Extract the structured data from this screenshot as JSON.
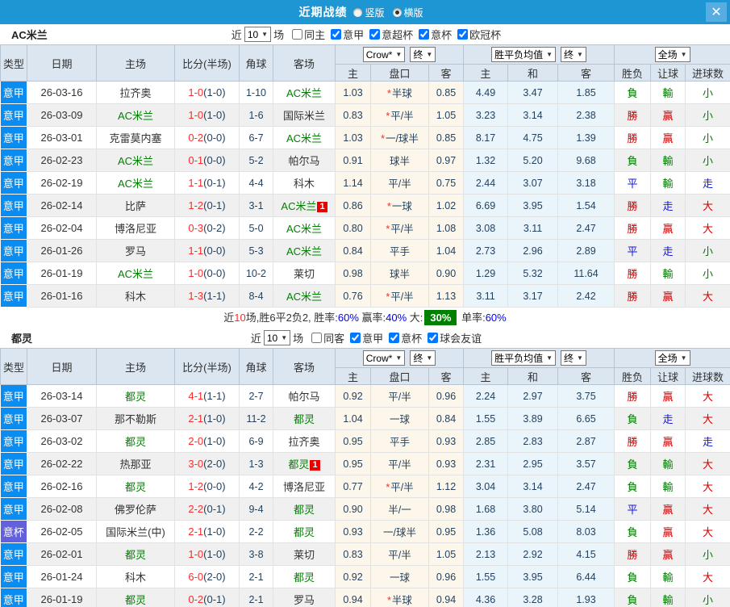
{
  "colors": {
    "bar": "#1e96d4",
    "barBtn": "#57ace1",
    "headerBg": "#dce6f1",
    "headerBorder": "#b7c4d3",
    "cellBorder": "#e2e2e2",
    "altRow": "#f0f0f0",
    "crowBg": "#fdf6ea",
    "avgBg": "#e9f4fb",
    "leagueBlue": "#0b8cf0",
    "cupPurple": "#6360dd",
    "teamGreen": "#008000",
    "scoreRed": "#ff2a2a",
    "numNavy": "#24425f",
    "winRed": "#d20000",
    "loseGreen": "#007800",
    "drawBlue": "#1515dd",
    "pctBlue": "#0000ee",
    "boxGreen": "#008000"
  },
  "header": {
    "title": "近期战绩",
    "close_glyph": "✕",
    "radios": [
      {
        "label": "竖版",
        "selected": false
      },
      {
        "label": "横版",
        "selected": true
      }
    ]
  },
  "columns": {
    "type": "类型",
    "date": "日期",
    "home": "主场",
    "score": "比分(半场)",
    "corner": "角球",
    "away": "客场",
    "odds_select": "Crow*",
    "odds_final": "终",
    "odds_cols": [
      "主",
      "盘口",
      "客"
    ],
    "avg_select": "胜平负均值",
    "avg_final": "终",
    "avg_cols": [
      "主",
      "和",
      "客"
    ],
    "full_select": "全场",
    "full_cols": [
      "胜负",
      "让球",
      "进球数"
    ]
  },
  "result_colors": {
    "勝": "red",
    "贏": "red",
    "大": "red",
    "平": "blue",
    "走": "blue",
    "負": "green",
    "輸": "green",
    "小": "green"
  },
  "sections": [
    {
      "team": "AC米兰",
      "filter": {
        "prefix": "近",
        "count": "10",
        "suffix": "场",
        "checks": [
          {
            "label": "同主",
            "checked": false
          },
          {
            "label": "意甲",
            "checked": true
          },
          {
            "label": "意超杯",
            "checked": true
          },
          {
            "label": "意杯",
            "checked": true
          },
          {
            "label": "欧冠杯",
            "checked": true
          }
        ]
      },
      "rows": [
        {
          "lg": "意甲",
          "cup": false,
          "d": "26-03-16",
          "h": "拉齐奥",
          "hG": false,
          "sc": "1-0",
          "hf": "(1-0)",
          "cn": "1-10",
          "a": "AC米兰",
          "aG": true,
          "bd": "",
          "o1": "1.03",
          "st": true,
          "hc": "半球",
          "o2": "0.85",
          "m1": "4.49",
          "m2": "3.47",
          "m3": "1.85",
          "r": [
            "負",
            "輸",
            "小"
          ]
        },
        {
          "lg": "意甲",
          "cup": false,
          "d": "26-03-09",
          "h": "AC米兰",
          "hG": true,
          "sc": "1-0",
          "hf": "(1-0)",
          "cn": "1-6",
          "a": "国际米兰",
          "aG": false,
          "bd": "",
          "o1": "0.83",
          "st": true,
          "hc": "平/半",
          "o2": "1.05",
          "m1": "3.23",
          "m2": "3.14",
          "m3": "2.38",
          "r": [
            "勝",
            "贏",
            "小"
          ]
        },
        {
          "lg": "意甲",
          "cup": false,
          "d": "26-03-01",
          "h": "克雷莫内塞",
          "hG": false,
          "sc": "0-2",
          "hf": "(0-0)",
          "cn": "6-7",
          "a": "AC米兰",
          "aG": true,
          "bd": "",
          "o1": "1.03",
          "st": true,
          "hc": "一/球半",
          "o2": "0.85",
          "m1": "8.17",
          "m2": "4.75",
          "m3": "1.39",
          "r": [
            "勝",
            "贏",
            "小"
          ]
        },
        {
          "lg": "意甲",
          "cup": false,
          "d": "26-02-23",
          "h": "AC米兰",
          "hG": true,
          "sc": "0-1",
          "hf": "(0-0)",
          "cn": "5-2",
          "a": "帕尔马",
          "aG": false,
          "bd": "",
          "o1": "0.91",
          "st": false,
          "hc": "球半",
          "o2": "0.97",
          "m1": "1.32",
          "m2": "5.20",
          "m3": "9.68",
          "r": [
            "負",
            "輸",
            "小"
          ]
        },
        {
          "lg": "意甲",
          "cup": false,
          "d": "26-02-19",
          "h": "AC米兰",
          "hG": true,
          "sc": "1-1",
          "hf": "(0-1)",
          "cn": "4-4",
          "a": "科木",
          "aG": false,
          "bd": "",
          "o1": "1.14",
          "st": false,
          "hc": "平/半",
          "o2": "0.75",
          "m1": "2.44",
          "m2": "3.07",
          "m3": "3.18",
          "r": [
            "平",
            "輸",
            "走"
          ]
        },
        {
          "lg": "意甲",
          "cup": false,
          "d": "26-02-14",
          "h": "比萨",
          "hG": false,
          "sc": "1-2",
          "hf": "(0-1)",
          "cn": "3-1",
          "a": "AC米兰",
          "aG": true,
          "bd": "a",
          "o1": "0.86",
          "st": true,
          "hc": "一球",
          "o2": "1.02",
          "m1": "6.69",
          "m2": "3.95",
          "m3": "1.54",
          "r": [
            "勝",
            "走",
            "大"
          ]
        },
        {
          "lg": "意甲",
          "cup": false,
          "d": "26-02-04",
          "h": "博洛尼亚",
          "hG": false,
          "sc": "0-3",
          "hf": "(0-2)",
          "cn": "5-0",
          "a": "AC米兰",
          "aG": true,
          "bd": "",
          "o1": "0.80",
          "st": true,
          "hc": "平/半",
          "o2": "1.08",
          "m1": "3.08",
          "m2": "3.11",
          "m3": "2.47",
          "r": [
            "勝",
            "贏",
            "大"
          ]
        },
        {
          "lg": "意甲",
          "cup": false,
          "d": "26-01-26",
          "h": "罗马",
          "hG": false,
          "sc": "1-1",
          "hf": "(0-0)",
          "cn": "5-3",
          "a": "AC米兰",
          "aG": true,
          "bd": "",
          "o1": "0.84",
          "st": false,
          "hc": "平手",
          "o2": "1.04",
          "m1": "2.73",
          "m2": "2.96",
          "m3": "2.89",
          "r": [
            "平",
            "走",
            "小"
          ]
        },
        {
          "lg": "意甲",
          "cup": false,
          "d": "26-01-19",
          "h": "AC米兰",
          "hG": true,
          "sc": "1-0",
          "hf": "(0-0)",
          "cn": "10-2",
          "a": "莱切",
          "aG": false,
          "bd": "",
          "o1": "0.98",
          "st": false,
          "hc": "球半",
          "o2": "0.90",
          "m1": "1.29",
          "m2": "5.32",
          "m3": "11.64",
          "r": [
            "勝",
            "輸",
            "小"
          ]
        },
        {
          "lg": "意甲",
          "cup": false,
          "d": "26-01-16",
          "h": "科木",
          "hG": false,
          "sc": "1-3",
          "hf": "(1-1)",
          "cn": "8-4",
          "a": "AC米兰",
          "aG": true,
          "bd": "",
          "o1": "0.76",
          "st": true,
          "hc": "平/半",
          "o2": "1.13",
          "m1": "3.11",
          "m2": "3.17",
          "m3": "2.42",
          "r": [
            "勝",
            "贏",
            "大"
          ]
        }
      ],
      "summary": [
        {
          "t": "近"
        },
        {
          "t": "10",
          "c": "red"
        },
        {
          "t": "场,胜6平2负2, 胜率:"
        },
        {
          "t": "60%",
          "c": "blue"
        },
        {
          "t": " 赢率:"
        },
        {
          "t": "40%",
          "c": "blue"
        },
        {
          "t": " 大:"
        },
        {
          "t": "30%",
          "c": "box"
        },
        {
          "t": " 单率:"
        },
        {
          "t": "60%",
          "c": "blue"
        }
      ]
    },
    {
      "team": "都灵",
      "filter": {
        "prefix": "近",
        "count": "10",
        "suffix": "场",
        "checks": [
          {
            "label": "同客",
            "checked": false
          },
          {
            "label": "意甲",
            "checked": true
          },
          {
            "label": "意杯",
            "checked": true
          },
          {
            "label": "球会友谊",
            "checked": true
          }
        ]
      },
      "rows": [
        {
          "lg": "意甲",
          "cup": false,
          "d": "26-03-14",
          "h": "都灵",
          "hG": true,
          "sc": "4-1",
          "hf": "(1-1)",
          "cn": "2-7",
          "a": "帕尔马",
          "aG": false,
          "bd": "",
          "o1": "0.92",
          "st": false,
          "hc": "平/半",
          "o2": "0.96",
          "m1": "2.24",
          "m2": "2.97",
          "m3": "3.75",
          "r": [
            "勝",
            "贏",
            "大"
          ]
        },
        {
          "lg": "意甲",
          "cup": false,
          "d": "26-03-07",
          "h": "那不勒斯",
          "hG": false,
          "sc": "2-1",
          "hf": "(1-0)",
          "cn": "11-2",
          "a": "都灵",
          "aG": true,
          "bd": "",
          "o1": "1.04",
          "st": false,
          "hc": "一球",
          "o2": "0.84",
          "m1": "1.55",
          "m2": "3.89",
          "m3": "6.65",
          "r": [
            "負",
            "走",
            "大"
          ]
        },
        {
          "lg": "意甲",
          "cup": false,
          "d": "26-03-02",
          "h": "都灵",
          "hG": true,
          "sc": "2-0",
          "hf": "(1-0)",
          "cn": "6-9",
          "a": "拉齐奥",
          "aG": false,
          "bd": "",
          "o1": "0.95",
          "st": false,
          "hc": "平手",
          "o2": "0.93",
          "m1": "2.85",
          "m2": "2.83",
          "m3": "2.87",
          "r": [
            "勝",
            "贏",
            "走"
          ]
        },
        {
          "lg": "意甲",
          "cup": false,
          "d": "26-02-22",
          "h": "热那亚",
          "hG": false,
          "sc": "3-0",
          "hf": "(2-0)",
          "cn": "1-3",
          "a": "都灵",
          "aG": true,
          "bd": "a",
          "o1": "0.95",
          "st": false,
          "hc": "平/半",
          "o2": "0.93",
          "m1": "2.31",
          "m2": "2.95",
          "m3": "3.57",
          "r": [
            "負",
            "輸",
            "大"
          ]
        },
        {
          "lg": "意甲",
          "cup": false,
          "d": "26-02-16",
          "h": "都灵",
          "hG": true,
          "sc": "1-2",
          "hf": "(0-0)",
          "cn": "4-2",
          "a": "博洛尼亚",
          "aG": false,
          "bd": "",
          "o1": "0.77",
          "st": true,
          "hc": "平/半",
          "o2": "1.12",
          "m1": "3.04",
          "m2": "3.14",
          "m3": "2.47",
          "r": [
            "負",
            "輸",
            "大"
          ]
        },
        {
          "lg": "意甲",
          "cup": false,
          "d": "26-02-08",
          "h": "佛罗伦萨",
          "hG": false,
          "sc": "2-2",
          "hf": "(0-1)",
          "cn": "9-4",
          "a": "都灵",
          "aG": true,
          "bd": "",
          "o1": "0.90",
          "st": false,
          "hc": "半/一",
          "o2": "0.98",
          "m1": "1.68",
          "m2": "3.80",
          "m3": "5.14",
          "r": [
            "平",
            "贏",
            "大"
          ]
        },
        {
          "lg": "意杯",
          "cup": true,
          "d": "26-02-05",
          "h": "国际米兰(中)",
          "hG": false,
          "sc": "2-1",
          "hf": "(1-0)",
          "cn": "2-2",
          "a": "都灵",
          "aG": true,
          "bd": "",
          "o1": "0.93",
          "st": false,
          "hc": "一/球半",
          "o2": "0.95",
          "m1": "1.36",
          "m2": "5.08",
          "m3": "8.03",
          "r": [
            "負",
            "贏",
            "大"
          ]
        },
        {
          "lg": "意甲",
          "cup": false,
          "d": "26-02-01",
          "h": "都灵",
          "hG": true,
          "sc": "1-0",
          "hf": "(1-0)",
          "cn": "3-8",
          "a": "莱切",
          "aG": false,
          "bd": "",
          "o1": "0.83",
          "st": false,
          "hc": "平/半",
          "o2": "1.05",
          "m1": "2.13",
          "m2": "2.92",
          "m3": "4.15",
          "r": [
            "勝",
            "贏",
            "小"
          ]
        },
        {
          "lg": "意甲",
          "cup": false,
          "d": "26-01-24",
          "h": "科木",
          "hG": false,
          "sc": "6-0",
          "hf": "(2-0)",
          "cn": "2-1",
          "a": "都灵",
          "aG": true,
          "bd": "",
          "o1": "0.92",
          "st": false,
          "hc": "一球",
          "o2": "0.96",
          "m1": "1.55",
          "m2": "3.95",
          "m3": "6.44",
          "r": [
            "負",
            "輸",
            "大"
          ]
        },
        {
          "lg": "意甲",
          "cup": false,
          "d": "26-01-19",
          "h": "都灵",
          "hG": true,
          "sc": "0-2",
          "hf": "(0-1)",
          "cn": "2-1",
          "a": "罗马",
          "aG": false,
          "bd": "",
          "o1": "0.94",
          "st": true,
          "hc": "半球",
          "o2": "0.94",
          "m1": "4.36",
          "m2": "3.28",
          "m3": "1.93",
          "r": [
            "負",
            "輸",
            "小"
          ]
        }
      ],
      "summary": null
    }
  ]
}
